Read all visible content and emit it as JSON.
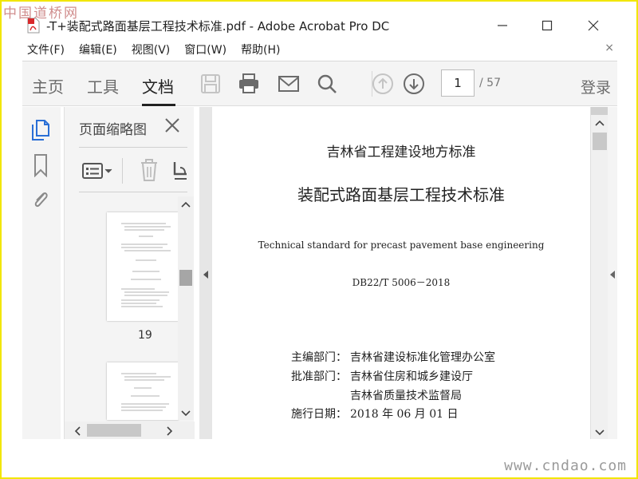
{
  "watermark": {
    "top": "中国道桥网",
    "bottom": "www.cndao.com"
  },
  "window": {
    "title": "-T+装配式路面基层工程技术标准.pdf - Adobe Acrobat Pro DC"
  },
  "menubar": {
    "items": [
      "文件(F)",
      "编辑(E)",
      "视图(V)",
      "窗口(W)",
      "帮助(H)"
    ]
  },
  "toolbar": {
    "tabs": [
      {
        "label": "主页",
        "active": false
      },
      {
        "label": "工具",
        "active": false
      },
      {
        "label": "文档",
        "active": true
      }
    ],
    "icons": [
      "save-icon",
      "print-icon",
      "email-icon",
      "search-icon",
      "prev-page-icon",
      "next-page-icon"
    ],
    "page_current": "1",
    "page_total": "/ 57",
    "login_label": "登录"
  },
  "thumbnail_panel": {
    "title": "页面缩略图",
    "page_label": "19"
  },
  "document": {
    "heading1": "吉林省工程建设地方标准",
    "heading2": "装配式路面基层工程技术标准",
    "english_title": "Technical standard for precast pavement base engineering",
    "code": "DB22/T 5006－2018",
    "info": [
      {
        "key": "主编部门：",
        "value": "吉林省建设标准化管理办公室"
      },
      {
        "key": "批准部门：",
        "value": "吉林省住房和城乡建设厅"
      },
      {
        "key": "",
        "value": "吉林省质量技术监督局"
      },
      {
        "key": "施行日期：",
        "value": "2018 年 06 月 01 日"
      }
    ]
  },
  "colors": {
    "accent_blue": "#2a6fd6",
    "icon_gray": "#6b6b6b",
    "frame_yellow": "#f2e600"
  }
}
